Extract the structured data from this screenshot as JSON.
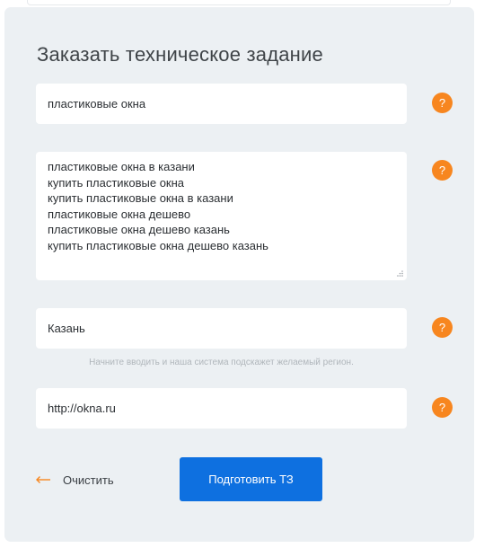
{
  "form": {
    "title": "Заказать техническое задание",
    "keyword": {
      "value": "пластиковые окна"
    },
    "phrases": {
      "lines": [
        "пластиковые окна в казани",
        "купить пластиковые окна",
        "купить пластиковые окна в казани",
        "пластиковые окна дешево",
        "пластиковые окна дешево казань",
        "купить пластиковые окна дешево казань"
      ]
    },
    "region": {
      "value": "Казань",
      "hint": "Начните вводить и наша система подскажет желаемый регион."
    },
    "site": {
      "value": "http://okna.ru"
    },
    "help_symbol": "?",
    "clear_label": "Очистить",
    "submit_label": "Подготовить ТЗ"
  },
  "icons": {
    "help": "help-circle-icon",
    "clear": "arrow-left-icon"
  },
  "colors": {
    "panel_bg": "#ecf0f3",
    "accent_orange": "#f7861f",
    "button_blue": "#0e70e0",
    "spellcheck_red": "#e53935"
  }
}
